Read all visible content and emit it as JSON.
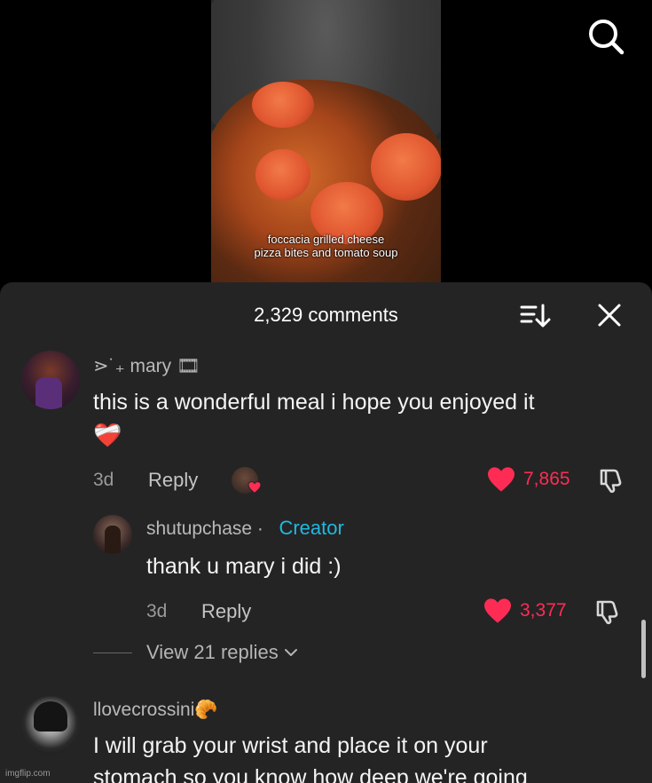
{
  "video": {
    "caption_line1": "foccacia grilled cheese",
    "caption_line2": "pizza bites and tomato soup"
  },
  "header": {
    "comment_count": "2,329 comments"
  },
  "comments": [
    {
      "username": "⋗˙₊ mary 🎞",
      "text": "this is a wonderful meal i hope you enjoyed it",
      "emoji": "❤️‍🩹",
      "time": "3d",
      "reply_label": "Reply",
      "likes": "7,865",
      "liked_by_creator": true
    },
    {
      "username": "shutupchase ·",
      "badge": "Creator",
      "text": "thank u mary i did :)",
      "time": "3d",
      "reply_label": "Reply",
      "likes": "3,377"
    },
    {
      "username": "llovecrossini🥐",
      "text_line1": "I will grab your wrist and place it on your",
      "text_line2": "stomach so you know how deep we're going"
    }
  ],
  "view_replies": "View 21 replies",
  "watermark": "imgflip.com",
  "colors": {
    "like": "#fe2c55",
    "creator": "#20b8e0",
    "sheet_bg": "#242424"
  },
  "icons": [
    "search-icon",
    "sort-icon",
    "close-icon",
    "heart-icon",
    "dislike-icon",
    "chevron-down-icon"
  ]
}
